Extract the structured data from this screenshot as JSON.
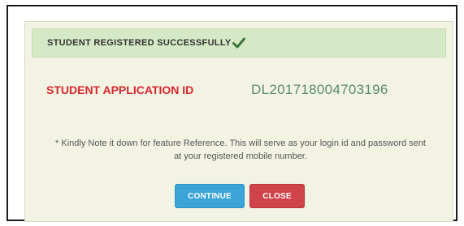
{
  "header": {
    "title": "STUDENT REGISTERED SUCCESSFULLY",
    "icon": "checkmark-icon"
  },
  "application": {
    "label": "STUDENT APPLICATION ID",
    "value": "DL201718004703196"
  },
  "note": {
    "text": "* Kindly Note it down for feature Reference. This will serve as your login id and password sent at your registered mobile number."
  },
  "buttons": {
    "continue_label": "CONTINUE",
    "close_label": "CLOSE"
  },
  "colors": {
    "header_bg": "#d6e9c6",
    "label_red": "#d9262e",
    "value_green": "#5b8a6b",
    "continue_blue": "#3aa4d8",
    "close_red": "#d0434a"
  }
}
